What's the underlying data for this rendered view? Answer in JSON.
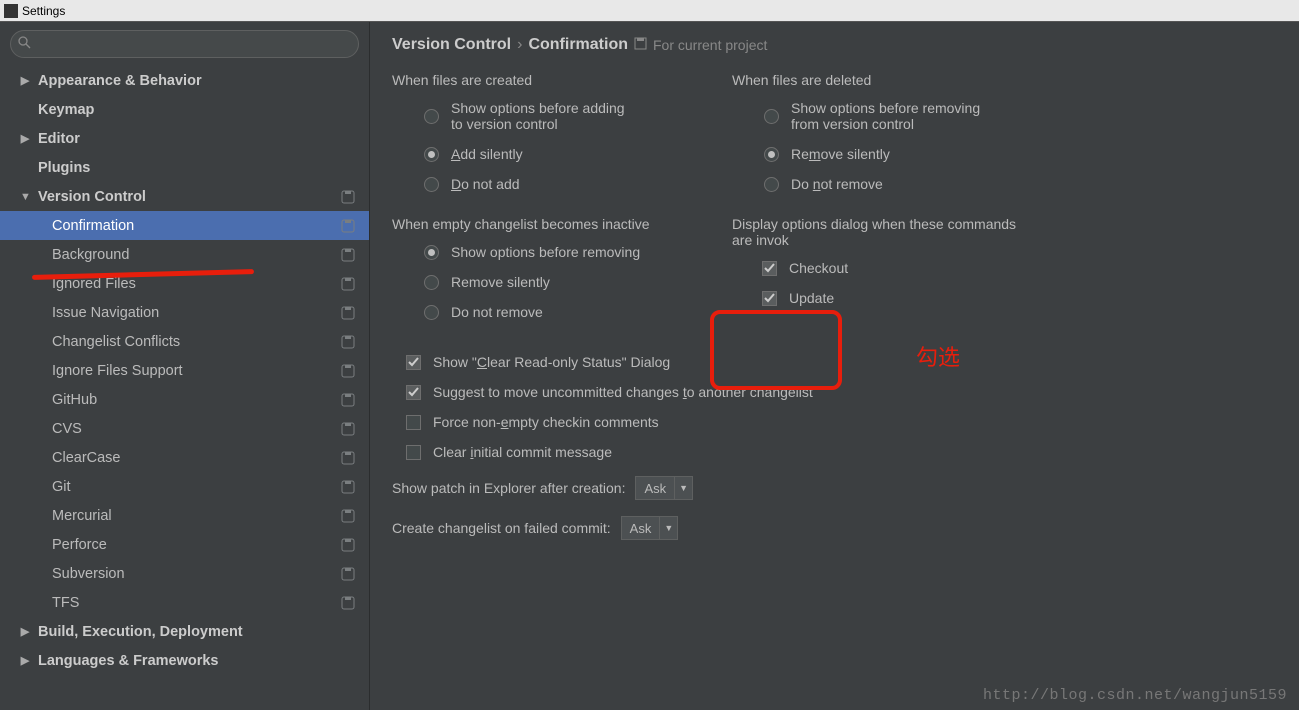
{
  "window": {
    "title": "Settings"
  },
  "search": {
    "placeholder": ""
  },
  "sidebar": {
    "items": [
      {
        "label": "Appearance & Behavior",
        "level": 1,
        "arrow": "right",
        "badge": false,
        "sel": false
      },
      {
        "label": "Keymap",
        "level": 1,
        "arrow": "",
        "badge": false,
        "sel": false
      },
      {
        "label": "Editor",
        "level": 1,
        "arrow": "right",
        "badge": false,
        "sel": false
      },
      {
        "label": "Plugins",
        "level": 1,
        "arrow": "",
        "badge": false,
        "sel": false
      },
      {
        "label": "Version Control",
        "level": 1,
        "arrow": "down",
        "badge": true,
        "sel": false
      },
      {
        "label": "Confirmation",
        "level": 2,
        "arrow": "",
        "badge": true,
        "sel": true
      },
      {
        "label": "Background",
        "level": 2,
        "arrow": "",
        "badge": true,
        "sel": false
      },
      {
        "label": "Ignored Files",
        "level": 2,
        "arrow": "",
        "badge": true,
        "sel": false
      },
      {
        "label": "Issue Navigation",
        "level": 2,
        "arrow": "",
        "badge": true,
        "sel": false
      },
      {
        "label": "Changelist Conflicts",
        "level": 2,
        "arrow": "",
        "badge": true,
        "sel": false
      },
      {
        "label": "Ignore Files Support",
        "level": 2,
        "arrow": "",
        "badge": true,
        "sel": false
      },
      {
        "label": "GitHub",
        "level": 2,
        "arrow": "",
        "badge": true,
        "sel": false
      },
      {
        "label": "CVS",
        "level": 2,
        "arrow": "",
        "badge": true,
        "sel": false
      },
      {
        "label": "ClearCase",
        "level": 2,
        "arrow": "",
        "badge": true,
        "sel": false
      },
      {
        "label": "Git",
        "level": 2,
        "arrow": "",
        "badge": true,
        "sel": false
      },
      {
        "label": "Mercurial",
        "level": 2,
        "arrow": "",
        "badge": true,
        "sel": false
      },
      {
        "label": "Perforce",
        "level": 2,
        "arrow": "",
        "badge": true,
        "sel": false
      },
      {
        "label": "Subversion",
        "level": 2,
        "arrow": "",
        "badge": true,
        "sel": false
      },
      {
        "label": "TFS",
        "level": 2,
        "arrow": "",
        "badge": true,
        "sel": false
      },
      {
        "label": "Build, Execution, Deployment",
        "level": 1,
        "arrow": "right",
        "badge": false,
        "sel": false
      },
      {
        "label": "Languages & Frameworks",
        "level": 1,
        "arrow": "right",
        "badge": false,
        "sel": false
      }
    ]
  },
  "breadcrumb": {
    "a": "Version Control",
    "sep": "›",
    "b": "Confirmation",
    "proj": "For current project"
  },
  "created": {
    "title": "When files are created",
    "opt1a": "Show options before adding",
    "opt1b": "to version control",
    "opt2": "Add silently",
    "opt3": "Do not add"
  },
  "deleted": {
    "title": "When files are deleted",
    "opt1a": "Show options before removing",
    "opt1b": "from version control",
    "opt2": "Remove silently",
    "opt3": "Do not remove"
  },
  "empty": {
    "title": "When empty changelist becomes inactive",
    "opt1": "Show options before removing",
    "opt2": "Remove silently",
    "opt3": "Do not remove"
  },
  "display": {
    "title": "Display options dialog when these commands are invok",
    "c1": "Checkout",
    "c2": "Update"
  },
  "misc": {
    "c1": "Show \"Clear Read-only Status\" Dialog",
    "c2": "Suggest to move uncommitted changes to another changelist",
    "c3": "Force non-empty checkin comments",
    "c4": "Clear initial commit message"
  },
  "drops": {
    "l1": "Show patch in Explorer after creation:",
    "v1": "Ask",
    "l2": "Create changelist on failed commit:",
    "v2": "Ask"
  },
  "annot": {
    "text": "勾选"
  },
  "watermark": "http://blog.csdn.net/wangjun5159"
}
